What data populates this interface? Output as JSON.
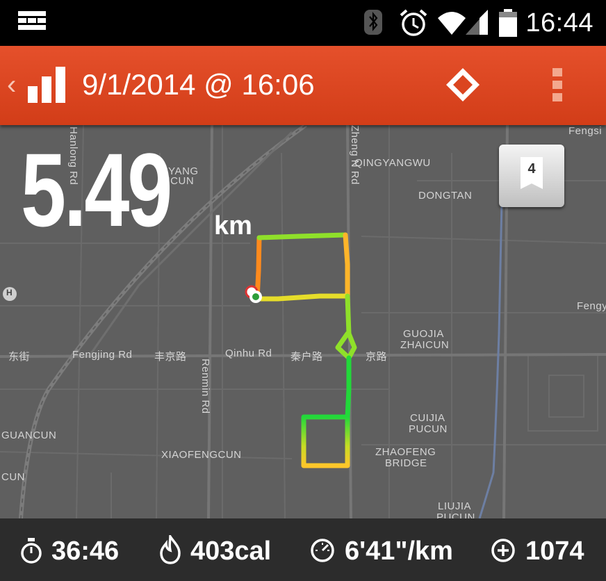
{
  "status_bar": {
    "time": "16:44",
    "icons": [
      "notification-icon",
      "bluetooth-icon",
      "alarm-icon",
      "wifi-icon",
      "cell-signal-icon",
      "battery-icon"
    ]
  },
  "action_bar": {
    "title": "9/1/2014 @ 16:06",
    "back_icon": "chevron-left-icon",
    "app_icon": "bar-chart-icon",
    "route_icon": "diamond-route-icon",
    "overflow_icon": "overflow-menu-icon",
    "color": "#db4520"
  },
  "run": {
    "distance": "5.49",
    "unit": "km",
    "lap_badge": "4"
  },
  "map_labels": {
    "qingyangwu": "QINGYANGWU",
    "dongtan": "DONGTAN",
    "fengsi": "Fengsi",
    "fengy": "Fengy",
    "guojia": "GUOJIA",
    "zhaicun": "ZHAICUN",
    "cuijia": "CUIJIA",
    "pucun1": "PUCUN",
    "zhaofeng": "ZHAOFENG",
    "bridge": "BRIDGE",
    "liujia": "LIUJIA",
    "pucun2": "PUCUN",
    "xiaofengcun": "XIAOFENGCUN",
    "guancun": "GUANCUN",
    "cun": "CUN",
    "dongjie": "东街",
    "fengjing_rd": "Fengjing Rd",
    "fengjing_cn": "丰京路",
    "qinhu_rd": "Qinhu Rd",
    "qinhu_cn": "秦户路",
    "jing_cn": "京路",
    "renmin_rd": "Renmin Rd",
    "zheng_n_rd": "Zheng N Rd",
    "hanlong_rd": "Hanlong Rd",
    "qingyang": "GYANG",
    "aicun": "AICUN",
    "hospital": "H"
  },
  "stats": {
    "duration": "36:46",
    "calories": "403cal",
    "pace": "6'41\"/km",
    "elevation": "1074",
    "icons": [
      "stopwatch-icon",
      "flame-icon",
      "speedometer-icon",
      "plus-circle-icon"
    ]
  },
  "colors": {
    "route_start": "#ff8a1d",
    "route_mid": "#22d83a",
    "route_end": "#ffd33a",
    "map_bg": "#5f5f5f",
    "stats_bg": "#2c2c2c"
  }
}
